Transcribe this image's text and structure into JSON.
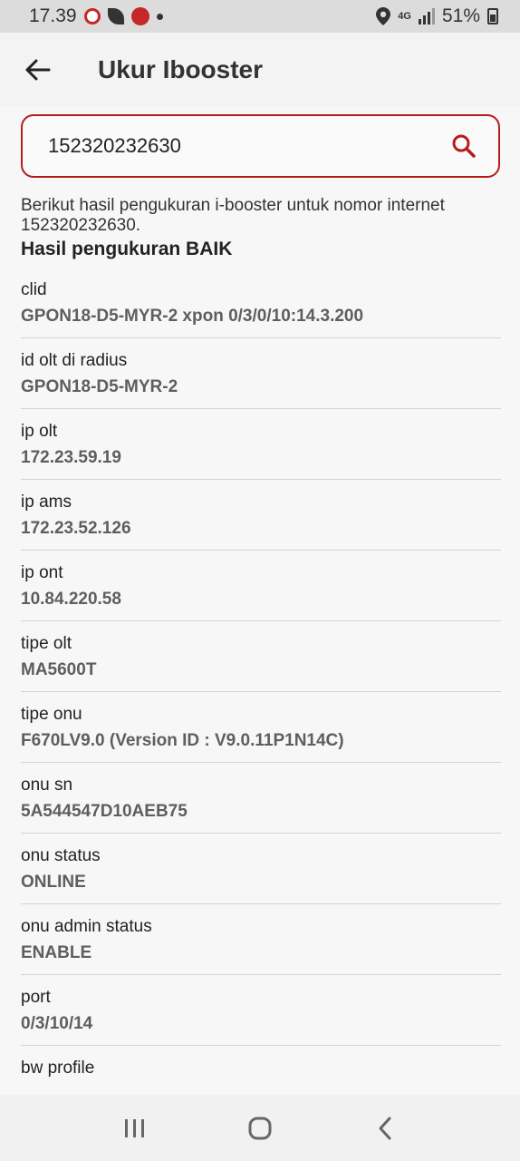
{
  "status_bar": {
    "time": "17.39",
    "network": "4G",
    "battery": "51%",
    "icons": [
      "notification-red-icon",
      "leaf-icon",
      "notification-app-icon",
      "dot-icon",
      "location-icon",
      "signal-icon",
      "battery-icon"
    ]
  },
  "app_bar": {
    "title": "Ukur Ibooster",
    "back_icon": "arrow-left-icon"
  },
  "search": {
    "value": "152320232630",
    "icon": "search-icon",
    "accent_color": "#b71c1c"
  },
  "result": {
    "intro": "Berikut hasil pengukuran i-booster untuk nomor internet 152320232630.",
    "heading": "Hasil pengukuran BAIK",
    "fields": [
      {
        "label": "clid",
        "value": "GPON18-D5-MYR-2 xpon 0/3/0/10:14.3.200"
      },
      {
        "label": "id olt di radius",
        "value": "GPON18-D5-MYR-2"
      },
      {
        "label": "ip olt",
        "value": "172.23.59.19"
      },
      {
        "label": "ip ams",
        "value": "172.23.52.126"
      },
      {
        "label": "ip ont",
        "value": "10.84.220.58"
      },
      {
        "label": "tipe olt",
        "value": "MA5600T"
      },
      {
        "label": "tipe onu",
        "value": "F670LV9.0 (Version ID : V9.0.11P1N14C)"
      },
      {
        "label": "onu sn",
        "value": "5A544547D10AEB75"
      },
      {
        "label": "onu status",
        "value": "ONLINE"
      },
      {
        "label": "onu admin status",
        "value": "ENABLE"
      },
      {
        "label": "port",
        "value": "0/3/10/14"
      },
      {
        "label": "bw profile",
        "value": ""
      }
    ]
  },
  "nav_bar": {
    "icons": [
      "recent-apps-icon",
      "home-icon",
      "back-icon"
    ]
  }
}
